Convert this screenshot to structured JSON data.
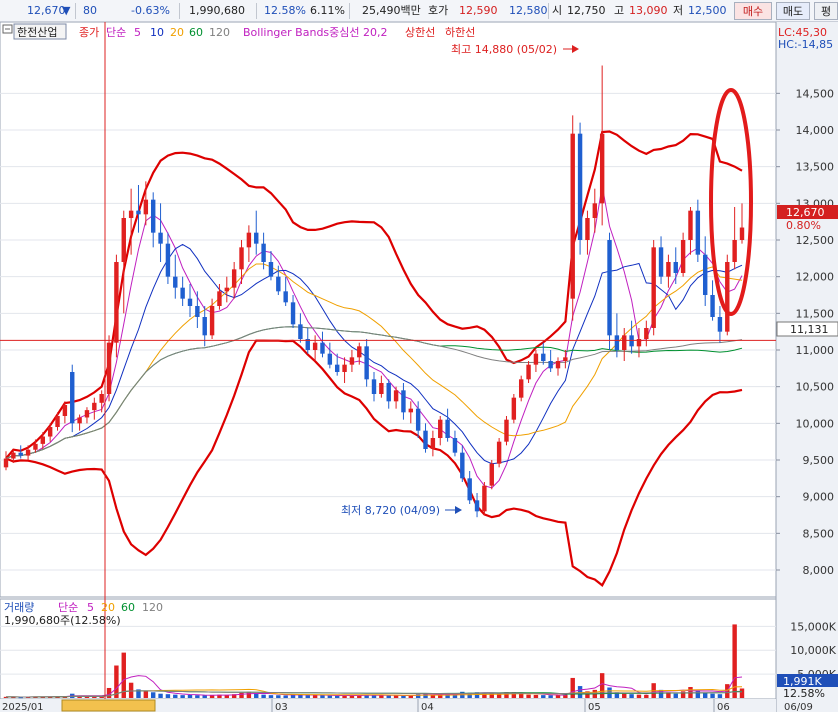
{
  "header": {
    "price": "12,670",
    "down_arrow": "▼",
    "change": "80",
    "change_pct": "-0.63%",
    "volume": "1,990,680",
    "turnover": "12.58%",
    "ratio": "6.11%",
    "amount": "25,490백만",
    "quote_label": "호가",
    "ask": "12,590",
    "bid": "12,580",
    "open_label": "시",
    "open": "12,750",
    "high_label": "고",
    "high": "13,090",
    "low_label": "저",
    "low": "12,500",
    "buy_button": "매수",
    "sell_button": "매도",
    "eval_button": "평"
  },
  "chart": {
    "stock_name": "한전산업",
    "legend": {
      "close_label": "종가",
      "ma_label": "단순",
      "ma": [
        "5",
        "10",
        "20",
        "60",
        "120"
      ],
      "bb_label": "Bollinger Bands중심선 20,2",
      "upper_label": "상한선",
      "lower_label": "하한선"
    },
    "lc_label": "LC:45,30",
    "hc_label": "HC:-14,85",
    "max_annotation": "최고 14,880 (05/02)",
    "min_annotation": "최저 8,720 (04/09)",
    "price_tag": "12,670",
    "pct_tag": "0.80%",
    "line_tag": "11,131",
    "volume_legend": {
      "title": "거래량",
      "ma_label": "단순",
      "ma": [
        "5",
        "20",
        "60",
        "120"
      ],
      "value": "1,990,680주(12.58%)"
    },
    "volume_tag": "1,991K",
    "volume_pct_tag": "12.58%",
    "x_labels": [
      "2025/01",
      "03",
      "04",
      "05",
      "06",
      "06/09"
    ]
  },
  "colors": {
    "up": "#e02020",
    "down": "#1f5fd0",
    "bollinger": "#dd0000",
    "ma5": "#c020c0",
    "ma10": "#1030c0",
    "ma20": "#f0a000",
    "ma60": "#009030",
    "ma120": "#808080"
  },
  "chart_data": {
    "type": "candlestick",
    "y_ticks": [
      8000,
      8500,
      9000,
      9500,
      10000,
      10500,
      11000,
      11500,
      12000,
      12500,
      13000,
      13500,
      14000,
      14500
    ],
    "ylim": [
      7700,
      15200
    ],
    "volume_ticks": [
      "5,000K",
      "10,000K",
      "15,000K"
    ],
    "volume_tick_values": [
      5000,
      10000,
      15000
    ],
    "volume_ylim": [
      0,
      18000
    ],
    "horizontal_line": 11131,
    "candles": [
      [
        9400,
        9620,
        9360,
        9520
      ],
      [
        9520,
        9640,
        9460,
        9600
      ],
      [
        9600,
        9700,
        9520,
        9560
      ],
      [
        9560,
        9700,
        9500,
        9640
      ],
      [
        9640,
        9780,
        9600,
        9720
      ],
      [
        9720,
        9880,
        9650,
        9820
      ],
      [
        9820,
        10000,
        9750,
        9950
      ],
      [
        9950,
        10150,
        9900,
        10100
      ],
      [
        10100,
        10300,
        10000,
        10250
      ],
      [
        10700,
        10800,
        9880,
        10000
      ],
      [
        10000,
        10120,
        9900,
        10080
      ],
      [
        10080,
        10220,
        10000,
        10180
      ],
      [
        10180,
        10350,
        10050,
        10280
      ],
      [
        10280,
        10450,
        10150,
        10400
      ],
      [
        10400,
        11200,
        10300,
        11100
      ],
      [
        11100,
        12300,
        10900,
        12200
      ],
      [
        12200,
        12900,
        11500,
        12800
      ],
      [
        12800,
        13200,
        12300,
        12900
      ],
      [
        12900,
        13250,
        12600,
        12850
      ],
      [
        12850,
        13300,
        12700,
        13050
      ],
      [
        13050,
        13150,
        12400,
        12600
      ],
      [
        12600,
        13000,
        12200,
        12450
      ],
      [
        12450,
        12600,
        11900,
        12000
      ],
      [
        12000,
        12300,
        11700,
        11850
      ],
      [
        11850,
        12000,
        11600,
        11700
      ],
      [
        11700,
        11900,
        11450,
        11600
      ],
      [
        11600,
        11800,
        11300,
        11450
      ],
      [
        11450,
        11600,
        11050,
        11200
      ],
      [
        11200,
        11700,
        11150,
        11600
      ],
      [
        11600,
        11900,
        11550,
        11800
      ],
      [
        11800,
        12000,
        11650,
        11850
      ],
      [
        11850,
        12200,
        11700,
        12100
      ],
      [
        12100,
        12500,
        11900,
        12400
      ],
      [
        12400,
        12700,
        12200,
        12600
      ],
      [
        12600,
        12900,
        12300,
        12450
      ],
      [
        12450,
        12600,
        12100,
        12200
      ],
      [
        12200,
        12350,
        11950,
        12000
      ],
      [
        12000,
        12150,
        11750,
        11800
      ],
      [
        11800,
        12000,
        11600,
        11650
      ],
      [
        11650,
        11750,
        11300,
        11350
      ],
      [
        11350,
        11500,
        11100,
        11150
      ],
      [
        11150,
        11300,
        10950,
        11000
      ],
      [
        11000,
        11200,
        10850,
        11100
      ],
      [
        11100,
        11250,
        10900,
        10950
      ],
      [
        10950,
        11100,
        10750,
        10800
      ],
      [
        10800,
        10950,
        10650,
        10700
      ],
      [
        10700,
        10900,
        10550,
        10800
      ],
      [
        10800,
        11000,
        10700,
        10900
      ],
      [
        10900,
        11100,
        10800,
        11050
      ],
      [
        11050,
        11150,
        10500,
        10600
      ],
      [
        10600,
        10700,
        10300,
        10400
      ],
      [
        10400,
        10650,
        10350,
        10550
      ],
      [
        10550,
        10600,
        10200,
        10300
      ],
      [
        10300,
        10500,
        10200,
        10450
      ],
      [
        10450,
        10550,
        10050,
        10150
      ],
      [
        10150,
        10300,
        10000,
        10200
      ],
      [
        10200,
        10300,
        9800,
        9900
      ],
      [
        9900,
        10000,
        9600,
        9650
      ],
      [
        9650,
        9900,
        9550,
        9800
      ],
      [
        9800,
        10100,
        9700,
        10050
      ],
      [
        10050,
        10200,
        9750,
        9800
      ],
      [
        9800,
        9900,
        9550,
        9600
      ],
      [
        9600,
        9700,
        9200,
        9250
      ],
      [
        9250,
        9350,
        8900,
        8950
      ],
      [
        8950,
        9050,
        8720,
        8800
      ],
      [
        8800,
        9200,
        8750,
        9150
      ],
      [
        9150,
        9500,
        9100,
        9450
      ],
      [
        9450,
        9800,
        9400,
        9750
      ],
      [
        9750,
        10100,
        9700,
        10050
      ],
      [
        10050,
        10400,
        10000,
        10350
      ],
      [
        10350,
        10650,
        10300,
        10600
      ],
      [
        10600,
        10850,
        10550,
        10800
      ],
      [
        10800,
        11000,
        10700,
        10950
      ],
      [
        10950,
        11100,
        10800,
        10850
      ],
      [
        10850,
        11000,
        10700,
        10750
      ],
      [
        10750,
        10900,
        10650,
        10850
      ],
      [
        10850,
        11000,
        10750,
        10900
      ],
      [
        11700,
        14200,
        11400,
        13950
      ],
      [
        13950,
        14100,
        12300,
        12500
      ],
      [
        12500,
        12900,
        12300,
        12800
      ],
      [
        12800,
        13200,
        12600,
        13000
      ],
      [
        13000,
        14880,
        12700,
        13950
      ],
      [
        12500,
        12600,
        11000,
        11200
      ],
      [
        11200,
        11500,
        10900,
        11000
      ],
      [
        11000,
        11300,
        10850,
        11200
      ],
      [
        11200,
        11400,
        10950,
        11050
      ],
      [
        11050,
        11300,
        10900,
        11150
      ],
      [
        11150,
        11400,
        11050,
        11300
      ],
      [
        11300,
        12500,
        11200,
        12400
      ],
      [
        12400,
        12550,
        11900,
        12000
      ],
      [
        12000,
        12300,
        11850,
        12200
      ],
      [
        12200,
        12400,
        11900,
        12050
      ],
      [
        12050,
        12600,
        12000,
        12500
      ],
      [
        12500,
        12950,
        12300,
        12900
      ],
      [
        12900,
        13050,
        12200,
        12300
      ],
      [
        12300,
        12550,
        11600,
        11750
      ],
      [
        11750,
        11950,
        11400,
        11450
      ],
      [
        11450,
        11600,
        11100,
        11250
      ],
      [
        11250,
        12300,
        11200,
        12200
      ],
      [
        12200,
        12950,
        12100,
        12500
      ],
      [
        12500,
        13000,
        12450,
        12670
      ]
    ],
    "volumes": [
      240,
      200,
      180,
      220,
      260,
      300,
      280,
      320,
      350,
      900,
      420,
      380,
      340,
      360,
      2100,
      6800,
      9500,
      3200,
      1800,
      1400,
      1200,
      900,
      800,
      700,
      600,
      650,
      580,
      520,
      600,
      700,
      650,
      800,
      1100,
      1300,
      900,
      700,
      600,
      580,
      520,
      800,
      700,
      600,
      560,
      520,
      500,
      480,
      520,
      560,
      600,
      700,
      540,
      560,
      520,
      540,
      500,
      520,
      800,
      1000,
      700,
      750,
      700,
      900,
      1300,
      1100,
      1200,
      900,
      1000,
      1100,
      1200,
      1200,
      900,
      700,
      650,
      600,
      580,
      600,
      620,
      4200,
      2500,
      1400,
      1700,
      5200,
      2200,
      1200,
      900,
      800,
      700,
      650,
      3100,
      1700,
      1200,
      900,
      1400,
      2300,
      1600,
      1100,
      900,
      800,
      2900,
      15400,
      1991
    ],
    "series": [
      {
        "name": "5",
        "color": "#c020c0"
      },
      {
        "name": "10",
        "color": "#1030c0"
      },
      {
        "name": "20",
        "color": "#f0a000"
      },
      {
        "name": "60",
        "color": "#009030"
      },
      {
        "name": "120",
        "color": "#808080"
      }
    ],
    "bollinger_period": 20,
    "bollinger_k": 2
  }
}
